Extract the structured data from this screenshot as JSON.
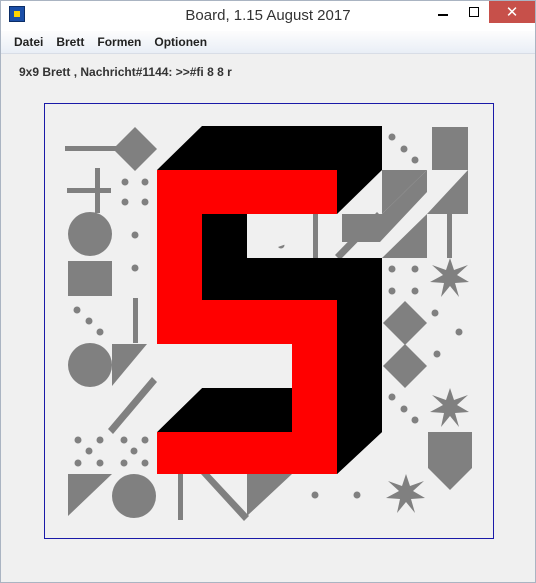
{
  "window": {
    "title": "Board, 1.15 August 2017",
    "minimize_icon": "minimize-icon",
    "maximize_icon": "maximize-icon",
    "close_icon": "close-icon",
    "close_glyph": "✕"
  },
  "menu": {
    "items": [
      "Datei",
      "Brett",
      "Formen",
      "Optionen"
    ]
  },
  "status": {
    "message": "9x9 Brett , Nachricht#1144: >>#fi 8 8 r"
  },
  "board": {
    "grid_size": "9x9",
    "colors": {
      "shape": "#808080",
      "digit_front": "#ff0000",
      "digit_shadow": "#000000",
      "border": "#1a1aa8"
    }
  }
}
